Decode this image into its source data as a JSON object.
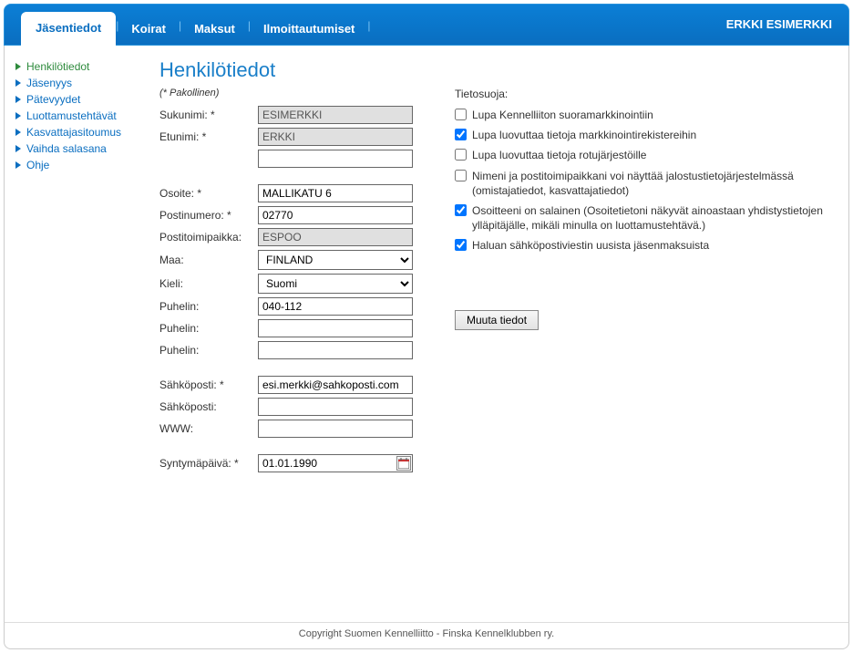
{
  "header": {
    "tabs": [
      "Jäsentiedot",
      "Koirat",
      "Maksut",
      "Ilmoittautumiset"
    ],
    "active_tab": 0,
    "username": "ERKKI ESIMERKKI"
  },
  "sidebar": {
    "items": [
      {
        "label": "Henkilötiedot",
        "active": true
      },
      {
        "label": "Jäsenyys",
        "active": false
      },
      {
        "label": "Pätevyydet",
        "active": false
      },
      {
        "label": "Luottamustehtävät",
        "active": false
      },
      {
        "label": "Kasvattajasitoumus",
        "active": false
      },
      {
        "label": "Vaihda salasana",
        "active": false
      },
      {
        "label": "Ohje",
        "active": false
      }
    ]
  },
  "page": {
    "title": "Henkilötiedot",
    "required_note": "(* Pakollinen)"
  },
  "form": {
    "labels": {
      "lastname": "Sukunimi: *",
      "firstname": "Etunimi: *",
      "address": "Osoite: *",
      "postal": "Postinumero: *",
      "city": "Postitoimipaikka:",
      "country": "Maa:",
      "language": "Kieli:",
      "phone": "Puhelin:",
      "email": "Sähköposti: *",
      "email2": "Sähköposti:",
      "www": "WWW:",
      "birthday": "Syntymäpäivä: *"
    },
    "values": {
      "lastname": "ESIMERKKI",
      "firstname": "ERKKI",
      "firstname2": "",
      "address": "MALLIKATU 6",
      "postal": "02770",
      "city": "ESPOO",
      "country": "FINLAND",
      "language": "Suomi",
      "phone1": "040-112",
      "phone2": "",
      "phone3": "",
      "email": "esi.merkki@sahkoposti.com",
      "email2": "",
      "www": "",
      "birthday": "01.01.1990"
    }
  },
  "privacy": {
    "title": "Tietosuoja:",
    "items": [
      {
        "label": "Lupa Kennelliiton suoramarkkinointiin",
        "checked": false
      },
      {
        "label": "Lupa luovuttaa tietoja markkinointirekistereihin",
        "checked": true
      },
      {
        "label": "Lupa luovuttaa tietoja rotujärjestöille",
        "checked": false
      },
      {
        "label": "Nimeni ja postitoimipaikkani voi näyttää jalostustietojärjestelmässä (omistajatiedot, kasvattajatiedot)",
        "checked": false
      },
      {
        "label": "Osoitteeni on salainen (Osoitetietoni näkyvät ainoastaan yhdistystietojen ylläpitäjälle, mikäli minulla on luottamustehtävä.)",
        "checked": true
      },
      {
        "label": "Haluan sähköpostiviestin uusista jäsenmaksuista",
        "checked": true
      }
    ],
    "button": "Muuta tiedot"
  },
  "footer": "Copyright Suomen Kennelliitto - Finska Kennelklubben ry."
}
